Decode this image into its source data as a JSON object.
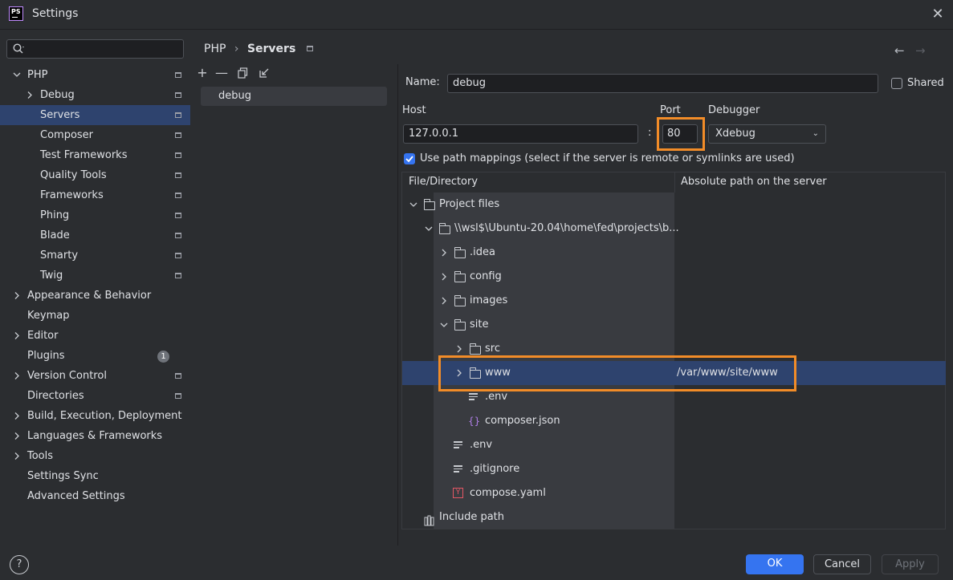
{
  "window": {
    "title": "Settings",
    "app_icon_text": "PS"
  },
  "sidebar": {
    "search_placeholder": "",
    "items": [
      {
        "label": "PHP",
        "expanded": true,
        "level": 0
      },
      {
        "label": "Debug",
        "level": 1
      },
      {
        "label": "Servers",
        "level": 1,
        "selected": true
      },
      {
        "label": "Composer",
        "level": 1
      },
      {
        "label": "Test Frameworks",
        "level": 1
      },
      {
        "label": "Quality Tools",
        "level": 1
      },
      {
        "label": "Frameworks",
        "level": 1
      },
      {
        "label": "Phing",
        "level": 1
      },
      {
        "label": "Blade",
        "level": 1
      },
      {
        "label": "Smarty",
        "level": 1
      },
      {
        "label": "Twig",
        "level": 1
      },
      {
        "label": "Appearance & Behavior",
        "level": 0
      },
      {
        "label": "Keymap",
        "level": 0
      },
      {
        "label": "Editor",
        "level": 0
      },
      {
        "label": "Plugins",
        "level": 0,
        "badge": "1"
      },
      {
        "label": "Version Control",
        "level": 0
      },
      {
        "label": "Directories",
        "level": 0
      },
      {
        "label": "Build, Execution, Deployment",
        "level": 0
      },
      {
        "label": "Languages & Frameworks",
        "level": 0
      },
      {
        "label": "Tools",
        "level": 0
      },
      {
        "label": "Settings Sync",
        "level": 0
      },
      {
        "label": "Advanced Settings",
        "level": 0
      }
    ]
  },
  "breadcrumb": {
    "parent": "PHP",
    "separator": "›",
    "current": "Servers"
  },
  "servers": {
    "list": [
      "debug"
    ]
  },
  "form": {
    "name_label": "Name:",
    "name_value": "debug",
    "shared_label": "Shared",
    "host_label": "Host",
    "host_value": "127.0.0.1",
    "colon": ":",
    "port_label": "Port",
    "port_value": "80",
    "debugger_label": "Debugger",
    "debugger_value": "Xdebug",
    "use_mappings_label": "Use path mappings (select if the server is remote or symlinks are used)"
  },
  "table": {
    "col_dir": "File/Directory",
    "col_abs": "Absolute path on the server",
    "rows": [
      {
        "label": "Project files",
        "icon": "folder"
      },
      {
        "label": "\\\\wsl$\\Ubuntu-20.04\\home\\fed\\projects\\b...",
        "icon": "folder"
      },
      {
        "label": ".idea",
        "icon": "folder"
      },
      {
        "label": "config",
        "icon": "folder"
      },
      {
        "label": "images",
        "icon": "folder"
      },
      {
        "label": "site",
        "icon": "folder"
      },
      {
        "label": "src",
        "icon": "folder"
      },
      {
        "label": "www",
        "icon": "folder",
        "server_path": "/var/www/site/www"
      },
      {
        "label": ".env",
        "icon": "text-file"
      },
      {
        "label": "composer.json",
        "icon": "json-file"
      },
      {
        "label": ".env",
        "icon": "text-file"
      },
      {
        "label": ".gitignore",
        "icon": "text-file"
      },
      {
        "label": "compose.yaml",
        "icon": "yaml-file"
      },
      {
        "label": "Include path",
        "icon": "library"
      }
    ]
  },
  "footer": {
    "help": "?",
    "ok": "OK",
    "cancel": "Cancel",
    "apply": "Apply"
  },
  "colors": {
    "accent": "#3574f0",
    "selection": "#2e436e",
    "highlight": "#f28c28",
    "background": "#2b2d30"
  }
}
